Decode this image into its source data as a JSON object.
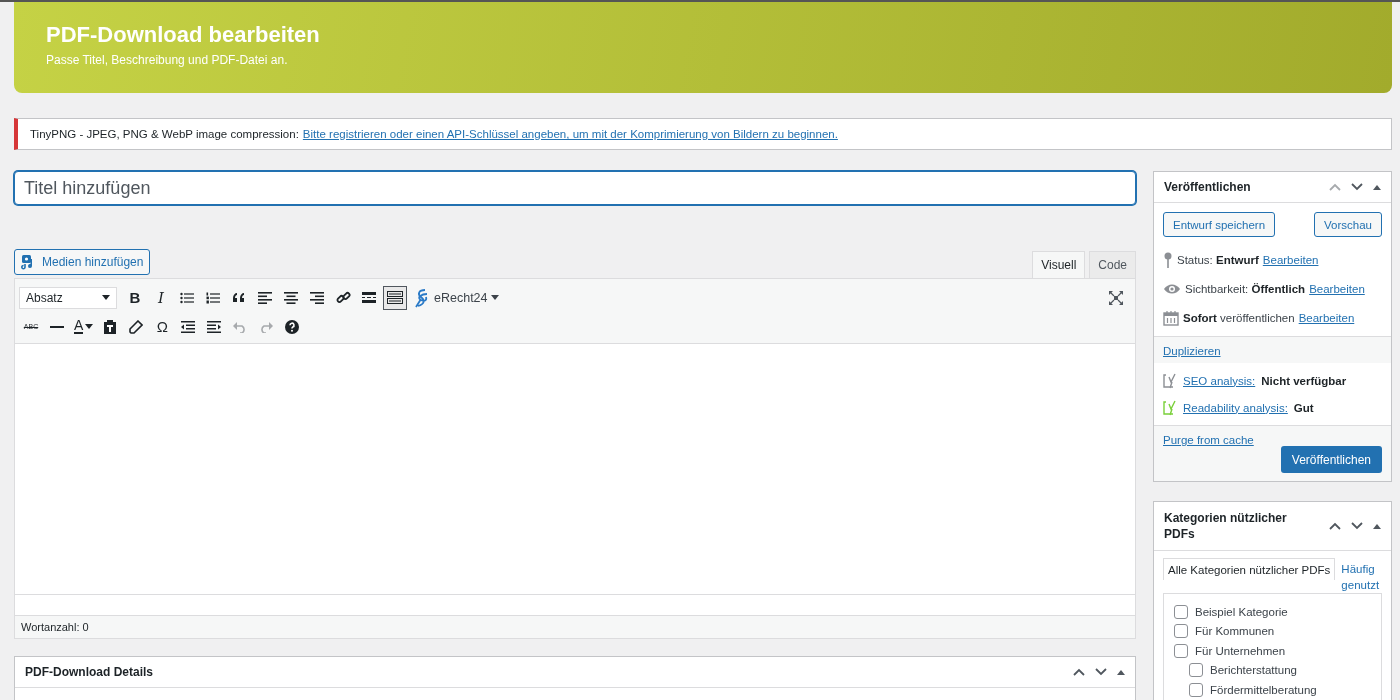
{
  "header": {
    "title": "PDF-Download bearbeiten",
    "subtitle": "Passe Titel, Beschreibung und PDF-Datei an."
  },
  "notice": {
    "text": "TinyPNG - JPEG, PNG & WebP image compression:",
    "link": "Bitte registrieren oder einen API-Schlüssel angeben, um mit der Komprimierung von Bildern zu beginnen."
  },
  "title_field": {
    "placeholder": "Titel hinzufügen"
  },
  "media_button": "Medien hinzufügen",
  "editor_tabs": [
    {
      "label": "Visuell",
      "selected": true
    },
    {
      "label": "Code",
      "selected": false
    }
  ],
  "format_select": "Absatz",
  "toolbar_row_1": [
    {
      "kind": "bold",
      "label": "B",
      "active": false,
      "disabled": false
    },
    {
      "kind": "italic",
      "label": "I",
      "active": false,
      "disabled": false
    },
    {
      "kind": "bullets",
      "active": false,
      "disabled": false
    },
    {
      "kind": "numbers",
      "active": false,
      "disabled": false
    },
    {
      "kind": "quote",
      "active": false,
      "disabled": false
    },
    {
      "kind": "align-left",
      "active": false,
      "disabled": false
    },
    {
      "kind": "align-center",
      "active": false,
      "disabled": false
    },
    {
      "kind": "align-right",
      "active": false,
      "disabled": false
    },
    {
      "kind": "link",
      "active": false,
      "disabled": false
    },
    {
      "kind": "more",
      "active": false,
      "disabled": false
    },
    {
      "kind": "toolbar-toggle",
      "active": true,
      "disabled": false
    }
  ],
  "erecht_menu": "eRecht24",
  "toolbar_row_2": [
    {
      "kind": "strike",
      "label": "ABC",
      "active": false,
      "disabled": false
    },
    {
      "kind": "hr",
      "active": false,
      "disabled": false
    },
    {
      "kind": "textcolor",
      "label": "A",
      "active": false,
      "disabled": false
    },
    {
      "kind": "paste",
      "active": false,
      "disabled": false
    },
    {
      "kind": "eraser",
      "active": false,
      "disabled": false
    },
    {
      "kind": "omega",
      "label": "Ω",
      "active": false,
      "disabled": false
    },
    {
      "kind": "outdent",
      "active": false,
      "disabled": false
    },
    {
      "kind": "indent",
      "active": false,
      "disabled": false
    },
    {
      "kind": "undo",
      "active": false,
      "disabled": true
    },
    {
      "kind": "redo",
      "active": false,
      "disabled": true
    },
    {
      "kind": "help",
      "active": false,
      "disabled": false
    }
  ],
  "word_count": "Wortanzahl: 0",
  "details_box": {
    "title": "PDF-Download Details"
  },
  "publish_box": {
    "title": "Veröffentlichen",
    "save_draft": "Entwurf speichern",
    "preview": "Vorschau",
    "rows": [
      {
        "kind": "status",
        "label": "Status:",
        "value": "Entwurf",
        "link": "Bearbeiten"
      },
      {
        "kind": "visibility",
        "label": "Sichtbarkeit:",
        "value": "Öffentlich",
        "link": "Bearbeiten"
      },
      {
        "kind": "schedule",
        "value": "Sofort",
        "label": "veröffentlichen",
        "link": "Bearbeiten"
      }
    ],
    "duplicate": "Duplizieren",
    "analyses": [
      {
        "link": "SEO analysis:",
        "value": "Nicht verfügbar",
        "color": "#8c8f94"
      },
      {
        "link": "Readability analysis:",
        "value": "Gut",
        "color": "#7ad03a"
      }
    ],
    "purge": "Purge from cache",
    "publish": "Veröffentlichen"
  },
  "categories_box": {
    "title": "Kategorien nützlicher PDFs",
    "tabs": [
      {
        "label": "Alle Kategorien nützlicher PDFs",
        "selected": true
      },
      {
        "label": "Häufig genutzt",
        "selected": false
      }
    ],
    "items": [
      {
        "label": "Beispiel Kategorie",
        "checked": false
      },
      {
        "label": "Für Kommunen",
        "checked": false
      },
      {
        "label": "Für Unternehmen",
        "checked": false,
        "children": [
          {
            "label": "Berichterstattung",
            "checked": false
          },
          {
            "label": "Fördermittelberatung",
            "checked": false
          }
        ]
      }
    ]
  }
}
